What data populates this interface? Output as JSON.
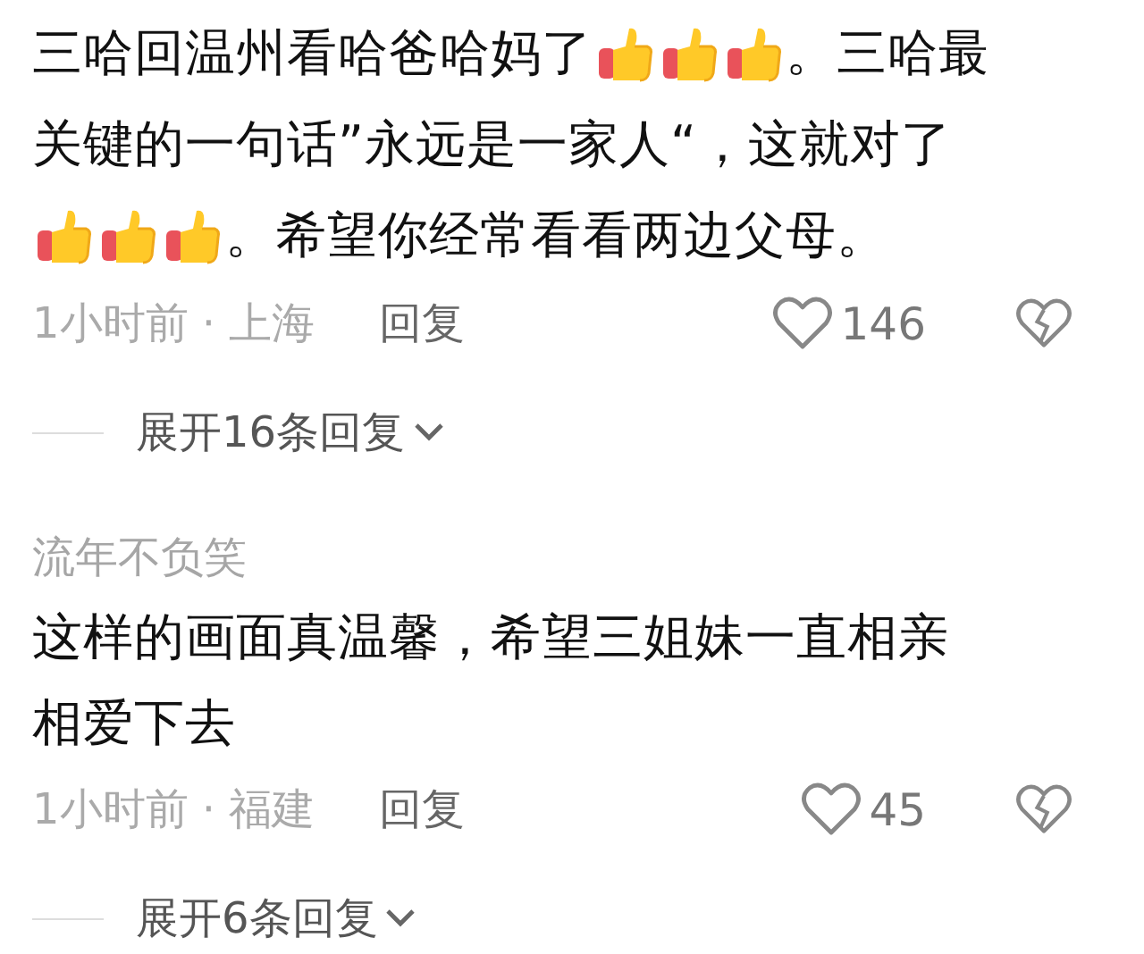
{
  "comments": [
    {
      "lines": [
        [
          {
            "kind": "text",
            "text": "三哈回温州看哈爸哈妈了"
          },
          {
            "kind": "thumb"
          },
          {
            "kind": "thumb"
          },
          {
            "kind": "thumb"
          },
          {
            "kind": "text",
            "text": "。三哈最"
          }
        ],
        [
          {
            "kind": "text",
            "text": "关键的一句话”永远是一家人“，这就对了"
          }
        ],
        [
          {
            "kind": "thumb"
          },
          {
            "kind": "thumb"
          },
          {
            "kind": "thumb"
          },
          {
            "kind": "text",
            "text": "。希望你经常看看两边父母。"
          }
        ]
      ],
      "meta": "1小时前 · 上海",
      "reply": "回复",
      "likes": "146",
      "expand": "展开16条回复"
    },
    {
      "username": "流年不负笑",
      "lines": [
        [
          {
            "kind": "text",
            "text": "这样的画面真温馨，希望三姐妹一直相亲"
          }
        ],
        [
          {
            "kind": "text",
            "text": "相爱下去"
          }
        ]
      ],
      "meta": "1小时前 · 福建",
      "reply": "回复",
      "likes": "45",
      "expand": "展开6条回复"
    }
  ]
}
